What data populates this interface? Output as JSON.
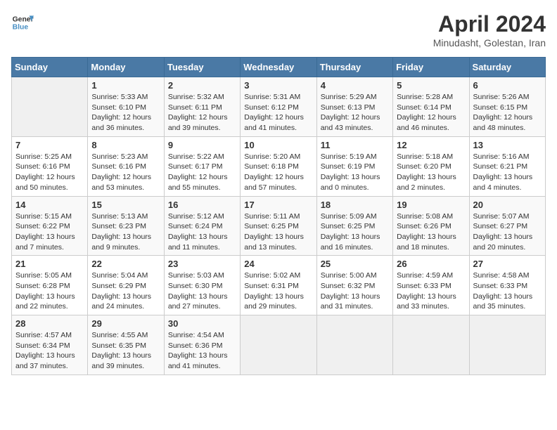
{
  "header": {
    "logo_line1": "General",
    "logo_line2": "Blue",
    "month_title": "April 2024",
    "location": "Minudasht, Golestan, Iran"
  },
  "weekdays": [
    "Sunday",
    "Monday",
    "Tuesday",
    "Wednesday",
    "Thursday",
    "Friday",
    "Saturday"
  ],
  "weeks": [
    [
      {
        "day": "",
        "sunrise": "",
        "sunset": "",
        "daylight": ""
      },
      {
        "day": "1",
        "sunrise": "Sunrise: 5:33 AM",
        "sunset": "Sunset: 6:10 PM",
        "daylight": "Daylight: 12 hours and 36 minutes."
      },
      {
        "day": "2",
        "sunrise": "Sunrise: 5:32 AM",
        "sunset": "Sunset: 6:11 PM",
        "daylight": "Daylight: 12 hours and 39 minutes."
      },
      {
        "day": "3",
        "sunrise": "Sunrise: 5:31 AM",
        "sunset": "Sunset: 6:12 PM",
        "daylight": "Daylight: 12 hours and 41 minutes."
      },
      {
        "day": "4",
        "sunrise": "Sunrise: 5:29 AM",
        "sunset": "Sunset: 6:13 PM",
        "daylight": "Daylight: 12 hours and 43 minutes."
      },
      {
        "day": "5",
        "sunrise": "Sunrise: 5:28 AM",
        "sunset": "Sunset: 6:14 PM",
        "daylight": "Daylight: 12 hours and 46 minutes."
      },
      {
        "day": "6",
        "sunrise": "Sunrise: 5:26 AM",
        "sunset": "Sunset: 6:15 PM",
        "daylight": "Daylight: 12 hours and 48 minutes."
      }
    ],
    [
      {
        "day": "7",
        "sunrise": "Sunrise: 5:25 AM",
        "sunset": "Sunset: 6:16 PM",
        "daylight": "Daylight: 12 hours and 50 minutes."
      },
      {
        "day": "8",
        "sunrise": "Sunrise: 5:23 AM",
        "sunset": "Sunset: 6:16 PM",
        "daylight": "Daylight: 12 hours and 53 minutes."
      },
      {
        "day": "9",
        "sunrise": "Sunrise: 5:22 AM",
        "sunset": "Sunset: 6:17 PM",
        "daylight": "Daylight: 12 hours and 55 minutes."
      },
      {
        "day": "10",
        "sunrise": "Sunrise: 5:20 AM",
        "sunset": "Sunset: 6:18 PM",
        "daylight": "Daylight: 12 hours and 57 minutes."
      },
      {
        "day": "11",
        "sunrise": "Sunrise: 5:19 AM",
        "sunset": "Sunset: 6:19 PM",
        "daylight": "Daylight: 13 hours and 0 minutes."
      },
      {
        "day": "12",
        "sunrise": "Sunrise: 5:18 AM",
        "sunset": "Sunset: 6:20 PM",
        "daylight": "Daylight: 13 hours and 2 minutes."
      },
      {
        "day": "13",
        "sunrise": "Sunrise: 5:16 AM",
        "sunset": "Sunset: 6:21 PM",
        "daylight": "Daylight: 13 hours and 4 minutes."
      }
    ],
    [
      {
        "day": "14",
        "sunrise": "Sunrise: 5:15 AM",
        "sunset": "Sunset: 6:22 PM",
        "daylight": "Daylight: 13 hours and 7 minutes."
      },
      {
        "day": "15",
        "sunrise": "Sunrise: 5:13 AM",
        "sunset": "Sunset: 6:23 PM",
        "daylight": "Daylight: 13 hours and 9 minutes."
      },
      {
        "day": "16",
        "sunrise": "Sunrise: 5:12 AM",
        "sunset": "Sunset: 6:24 PM",
        "daylight": "Daylight: 13 hours and 11 minutes."
      },
      {
        "day": "17",
        "sunrise": "Sunrise: 5:11 AM",
        "sunset": "Sunset: 6:25 PM",
        "daylight": "Daylight: 13 hours and 13 minutes."
      },
      {
        "day": "18",
        "sunrise": "Sunrise: 5:09 AM",
        "sunset": "Sunset: 6:25 PM",
        "daylight": "Daylight: 13 hours and 16 minutes."
      },
      {
        "day": "19",
        "sunrise": "Sunrise: 5:08 AM",
        "sunset": "Sunset: 6:26 PM",
        "daylight": "Daylight: 13 hours and 18 minutes."
      },
      {
        "day": "20",
        "sunrise": "Sunrise: 5:07 AM",
        "sunset": "Sunset: 6:27 PM",
        "daylight": "Daylight: 13 hours and 20 minutes."
      }
    ],
    [
      {
        "day": "21",
        "sunrise": "Sunrise: 5:05 AM",
        "sunset": "Sunset: 6:28 PM",
        "daylight": "Daylight: 13 hours and 22 minutes."
      },
      {
        "day": "22",
        "sunrise": "Sunrise: 5:04 AM",
        "sunset": "Sunset: 6:29 PM",
        "daylight": "Daylight: 13 hours and 24 minutes."
      },
      {
        "day": "23",
        "sunrise": "Sunrise: 5:03 AM",
        "sunset": "Sunset: 6:30 PM",
        "daylight": "Daylight: 13 hours and 27 minutes."
      },
      {
        "day": "24",
        "sunrise": "Sunrise: 5:02 AM",
        "sunset": "Sunset: 6:31 PM",
        "daylight": "Daylight: 13 hours and 29 minutes."
      },
      {
        "day": "25",
        "sunrise": "Sunrise: 5:00 AM",
        "sunset": "Sunset: 6:32 PM",
        "daylight": "Daylight: 13 hours and 31 minutes."
      },
      {
        "day": "26",
        "sunrise": "Sunrise: 4:59 AM",
        "sunset": "Sunset: 6:33 PM",
        "daylight": "Daylight: 13 hours and 33 minutes."
      },
      {
        "day": "27",
        "sunrise": "Sunrise: 4:58 AM",
        "sunset": "Sunset: 6:33 PM",
        "daylight": "Daylight: 13 hours and 35 minutes."
      }
    ],
    [
      {
        "day": "28",
        "sunrise": "Sunrise: 4:57 AM",
        "sunset": "Sunset: 6:34 PM",
        "daylight": "Daylight: 13 hours and 37 minutes."
      },
      {
        "day": "29",
        "sunrise": "Sunrise: 4:55 AM",
        "sunset": "Sunset: 6:35 PM",
        "daylight": "Daylight: 13 hours and 39 minutes."
      },
      {
        "day": "30",
        "sunrise": "Sunrise: 4:54 AM",
        "sunset": "Sunset: 6:36 PM",
        "daylight": "Daylight: 13 hours and 41 minutes."
      },
      {
        "day": "",
        "sunrise": "",
        "sunset": "",
        "daylight": ""
      },
      {
        "day": "",
        "sunrise": "",
        "sunset": "",
        "daylight": ""
      },
      {
        "day": "",
        "sunrise": "",
        "sunset": "",
        "daylight": ""
      },
      {
        "day": "",
        "sunrise": "",
        "sunset": "",
        "daylight": ""
      }
    ]
  ]
}
